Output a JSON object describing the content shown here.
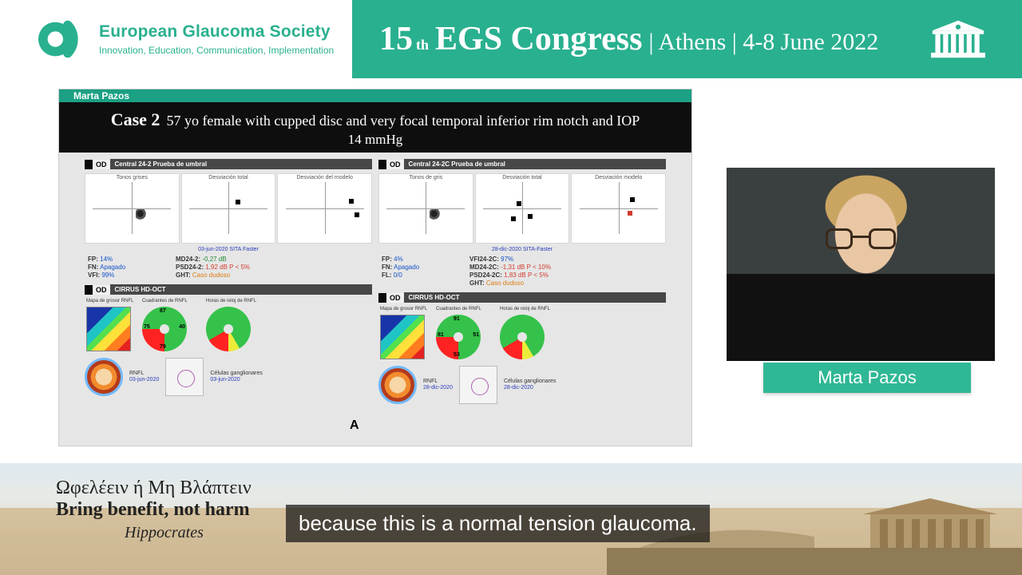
{
  "header": {
    "org_name": "European Glaucoma Society",
    "org_tag": "Innovation, Education, Communication, Implementation",
    "cong_15": "15",
    "cong_th": "th",
    "cong_main": "EGS Congress",
    "cong_sub": "| Athens | 4-8 June 2022"
  },
  "slide": {
    "whitebar": "Marta Pazos",
    "case_id": "Case 2",
    "case_desc": "57 yo female with cupped disc and very focal temporal inferior rim notch and IOP",
    "case_iop": "14 mmHg",
    "tag_A": "A",
    "eye_label": "OD",
    "left": {
      "panel1_title": "Central 24-2 Prueba de umbral",
      "vf_labels": {
        "a": "Tonos grises",
        "b": "Desviación total",
        "c": "Desviación del modelo"
      },
      "date": "03-jun-2020  SITA Faster",
      "stats": {
        "fp_l": "FP:",
        "fp_v": "14%",
        "fn_l": "FN:",
        "fn_v": "Apagado",
        "vfi_l": "VFI:",
        "vfi_v": "99%",
        "md_l": "MD24-2:",
        "md_v": "-0,27 dB",
        "psd_l": "PSD24-2:",
        "psd_v": "1,92 dB P < 5%",
        "ght_l": "GHT:",
        "ght_v": "Caso dudoso"
      },
      "oct_title": "CIRRUS HD-OCT",
      "oct_cols": {
        "a": "Mapa de grosor RNFL",
        "b": "Cuadrantes de RNFL",
        "c": "Horas de reloj de RNFL"
      },
      "quad": {
        "t": "87",
        "r": "40",
        "b": "79",
        "l": "75"
      },
      "rnfl_date": "03-jun-2020",
      "disc2_label": "Células ganglionares"
    },
    "right": {
      "panel1_title": "Central 24-2C Prueba de umbral",
      "vf_labels": {
        "a": "Tonos de gris",
        "b": "Desviación total",
        "c": "Desviación modelo"
      },
      "date": "28-dic-2020  SITA-Faster",
      "stats": {
        "fp_l": "FP:",
        "fp_v": "4%",
        "fn_l": "FN:",
        "fn_v": "Apagado",
        "fl_l": "FL:",
        "fl_v": "0/0",
        "vfi_l": "VFI24-2C:",
        "vfi_v": "97%",
        "md_l": "MD24-2C:",
        "md_v": "-1,31 dB P < 10%",
        "psd_l": "PSD24-2C:",
        "psd_v": "1,83 dB P < 5%",
        "ght_l": "GHT:",
        "ght_v": "Caso dudoso"
      },
      "oct_title": "CIRRUS HD-OCT",
      "oct_cols": {
        "a": "Mapa de grosor RNFL",
        "b": "Cuadrantes de RNFL",
        "c": "Horas de reloj de RNFL"
      },
      "quad": {
        "t": "91",
        "r": "51",
        "b": "53",
        "l": "81"
      },
      "rnfl_date": "28-dic-2020",
      "disc2_label": "Células ganglionares"
    }
  },
  "speaker": {
    "name": "Marta Pazos"
  },
  "footer": {
    "quote_gk": "Ωφελέειν ή Μη Βλάπτειν",
    "quote_en": "Bring benefit, not harm",
    "quote_src": "Hippocrates",
    "caption": "because this is a normal tension glaucoma."
  }
}
